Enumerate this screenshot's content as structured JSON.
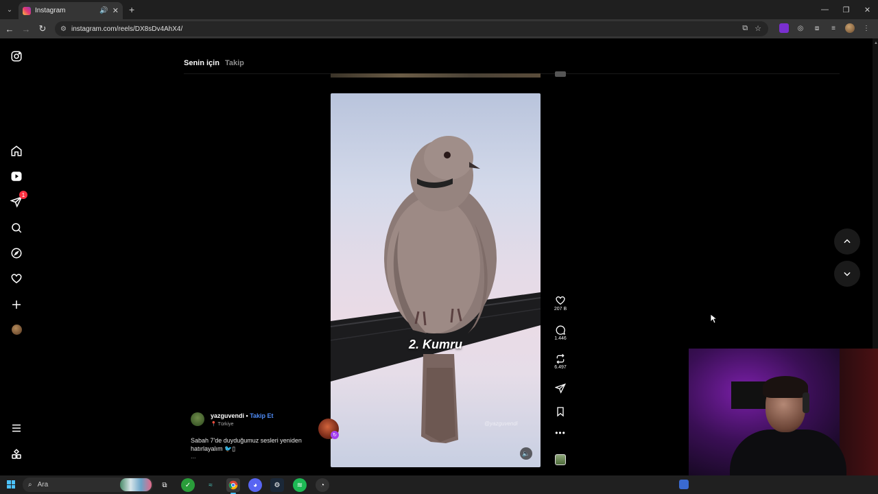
{
  "browser": {
    "tab_title": "Instagram",
    "url": "instagram.com/reels/DX8sDv4AhX4/"
  },
  "sidebar": {
    "notification_count": "1"
  },
  "feed_tabs": {
    "for_you": "Senin için",
    "following": "Takip"
  },
  "reel": {
    "overlay_text": "2. Kumru",
    "watermark": "@yazguvendi",
    "author": "yazguvendi",
    "separator": "•",
    "follow_label": "Takip Et",
    "location": "Türkiye",
    "caption": "Sabah 7'de duyduğumuz sesleri yeniden hatırlayalım 🐦▯",
    "caption_more": "...",
    "likes": "207 B",
    "comments": "1.446",
    "reposts": "6.497"
  },
  "taskbar": {
    "search_placeholder": "Ara"
  },
  "colors": {
    "accent_blue": "#4f8cf7",
    "notification_red": "#ff3040"
  }
}
